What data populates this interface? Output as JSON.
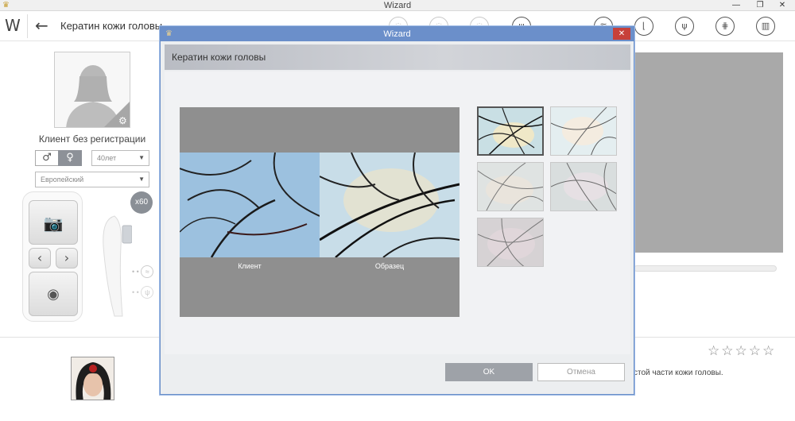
{
  "window": {
    "title": "Wizard",
    "minimize": "—",
    "maximize": "❐",
    "close": "✕"
  },
  "header": {
    "title": "Кератин кожи головы",
    "back_icon": "arrow-left-icon",
    "logo_icon": "w-logo-icon"
  },
  "toolbar_icons": [
    "hair-density-icon",
    "scalp-oil-icon",
    "follicle-icon",
    "hair-growth-icon",
    "scalp-sensitivity-icon",
    "hair-thickness-icon",
    "hair-loss-icon",
    "scalp-keratin-icon",
    "report-icon"
  ],
  "left_panel": {
    "client_name": "Клиент без регистрации",
    "gender_male": "♂",
    "gender_female": "♀",
    "age": "40лет",
    "ethnicity": "Европейский",
    "magnification": "x60",
    "remote": {
      "camera_icon": "camera-icon",
      "prev_icon": "chevron-left-icon",
      "next_icon": "chevron-right-icon",
      "capture_icon": "record-icon"
    }
  },
  "right_panel": {
    "description": "стой части кожи головы.",
    "rating_stars": "☆☆☆☆☆"
  },
  "dialog": {
    "title": "Wizard",
    "header": "Кератин кожи головы",
    "compare": {
      "left_label": "Клиент",
      "right_label": "Образец"
    },
    "ok_label": "OK",
    "cancel_label": "Отмена"
  },
  "colors": {
    "dialog_border": "#6a8fc8",
    "dialog_titlebar": "#6b8fca",
    "close_red": "#c7403a",
    "ok_gray": "#9ea2a8"
  }
}
